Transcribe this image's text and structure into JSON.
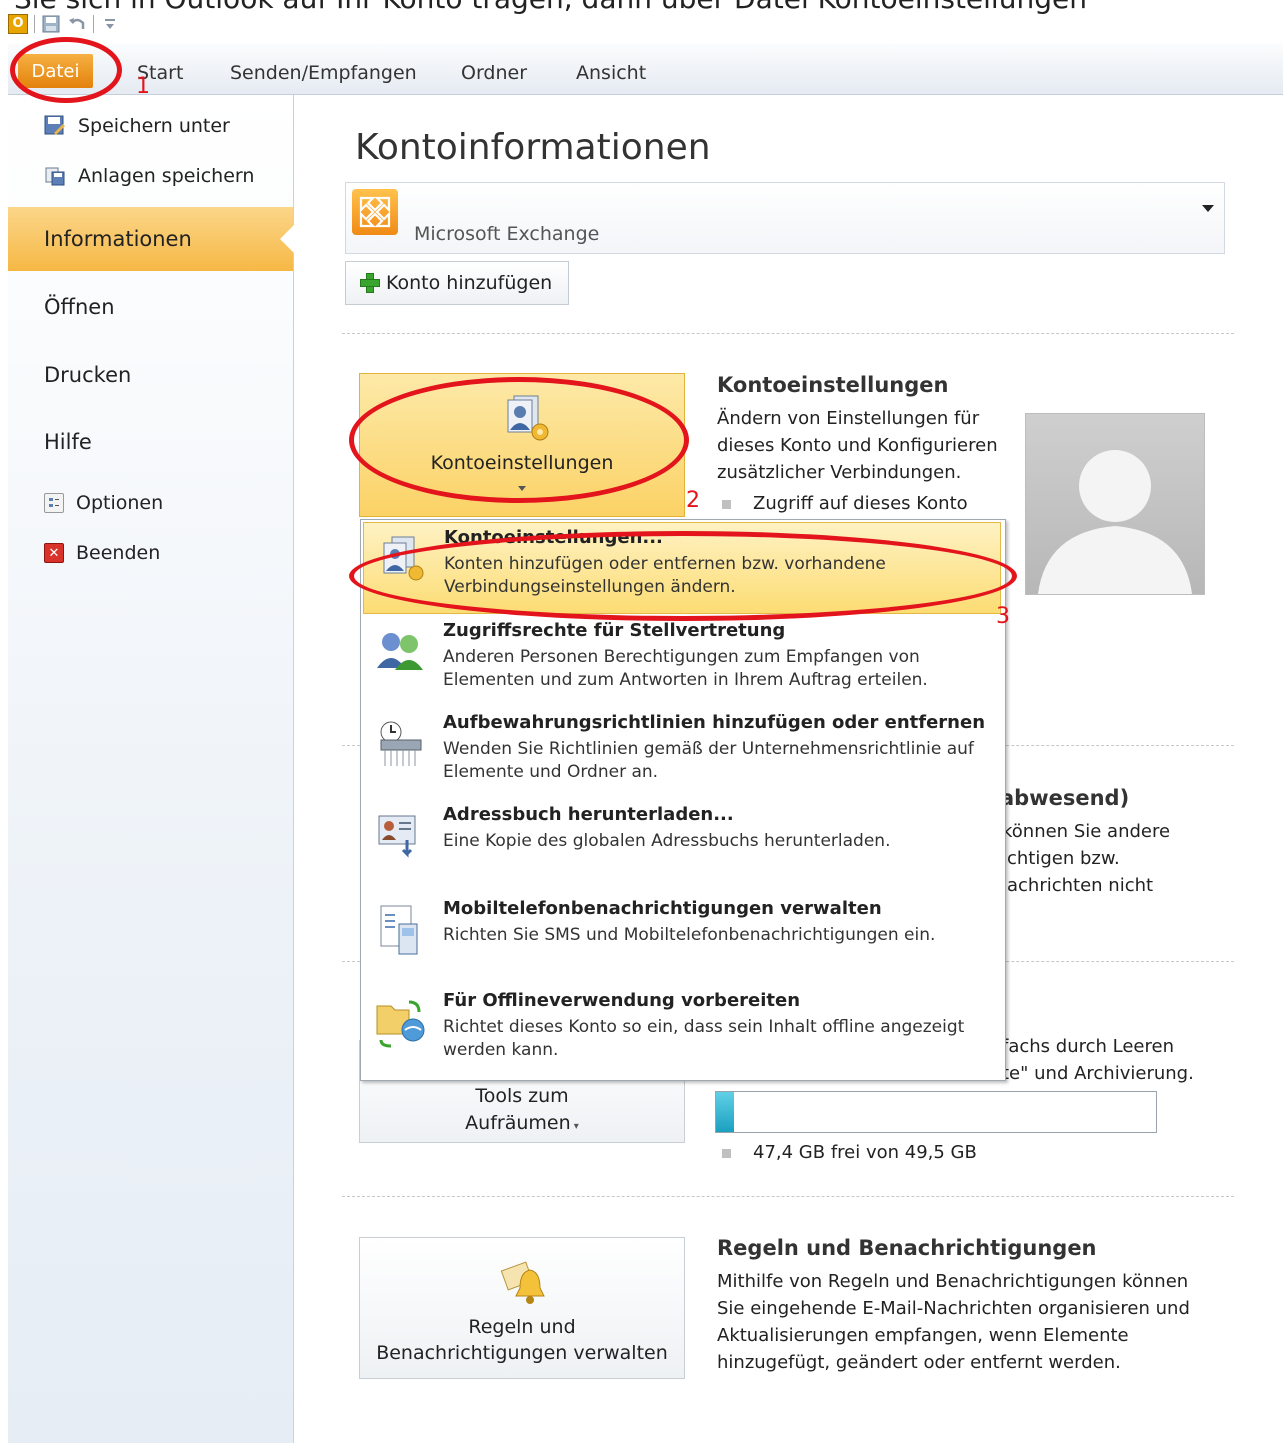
{
  "cut_text": "Sie sich in Outlook auf Ihr Konto tragen, dann über Datei Kontoeinstellungen",
  "quick_access": {
    "app_icon": "outlook-icon",
    "save_icon": "save-icon",
    "undo_icon": "undo-icon",
    "customize_icon": "customize-qat-icon"
  },
  "ribbon": {
    "tabs": [
      "Datei",
      "Start",
      "Senden/Empfangen",
      "Ordner",
      "Ansicht"
    ]
  },
  "nav": {
    "save_as": "Speichern unter",
    "save_attachments": "Anlagen speichern",
    "info": "Informationen",
    "open": "Öffnen",
    "print": "Drucken",
    "help": "Hilfe",
    "options": "Optionen",
    "exit": "Beenden"
  },
  "main": {
    "title": "Kontoinformationen",
    "account": "Microsoft Exchange",
    "add_account": "Konto hinzufügen",
    "account_settings": {
      "button": "Kontoeinstellungen",
      "title": "Kontoeinstellungen",
      "desc": "Ändern von Einstellungen für dieses Konto und Konfigurieren zusätzlicher Verbindungen.",
      "bullet": "Zugriff auf dieses Konto"
    },
    "out_of_office": {
      "title_fragment": "abwesend)",
      "desc_lines": [
        "können Sie andere",
        "ichtigen bzw.",
        "lachrichten nicht"
      ]
    },
    "cleanup": {
      "desc_lines": [
        "fachs durch Leeren",
        "te\" und Archivierung."
      ],
      "button_line1": "Tools zum",
      "button_line2": "Aufräumen",
      "storage_text": "47,4 GB frei von 49,5 GB",
      "storage_used_fraction": 0.04
    },
    "rules": {
      "button_line1": "Regeln und",
      "button_line2": "Benachrichtigungen verwalten",
      "title": "Regeln und Benachrichtigungen",
      "desc": "Mithilfe von Regeln und Benachrichtigungen können Sie eingehende E-Mail-Nachrichten organisieren und Aktualisierungen empfangen, wenn Elemente hinzugefügt, geändert oder entfernt werden."
    }
  },
  "dropdown": {
    "items": [
      {
        "title": "Kontoeinstellungen...",
        "desc": "Konten hinzufügen oder entfernen bzw. vorhandene Verbindungseinstellungen ändern."
      },
      {
        "title": "Zugriffsrechte für Stellvertretung",
        "desc": "Anderen Personen Berechtigungen zum Empfangen von Elementen und zum Antworten in Ihrem Auftrag erteilen."
      },
      {
        "title": "Aufbewahrungsrichtlinien hinzufügen oder entfernen",
        "desc": "Wenden Sie Richtlinien gemäß der Unternehmensrichtlinie auf Elemente und Ordner an."
      },
      {
        "title": "Adressbuch herunterladen...",
        "desc": "Eine Kopie des globalen Adressbuchs herunterladen."
      },
      {
        "title": "Mobiltelefonbenachrichtigungen verwalten",
        "desc": "Richten Sie SMS und Mobiltelefonbenachrichtigungen ein."
      },
      {
        "title": "Für Offlineverwendung vorbereiten",
        "desc": "Richtet dieses Konto so ein, dass sein Inhalt offline angezeigt werden kann."
      }
    ]
  },
  "annotations": {
    "one": "1",
    "two": "2",
    "three": "3",
    "color": "#e3141b"
  },
  "colors": {
    "accent_orange": "#f6b845",
    "datei_tab": "#e3820c",
    "highlight": "#fcdc73"
  }
}
